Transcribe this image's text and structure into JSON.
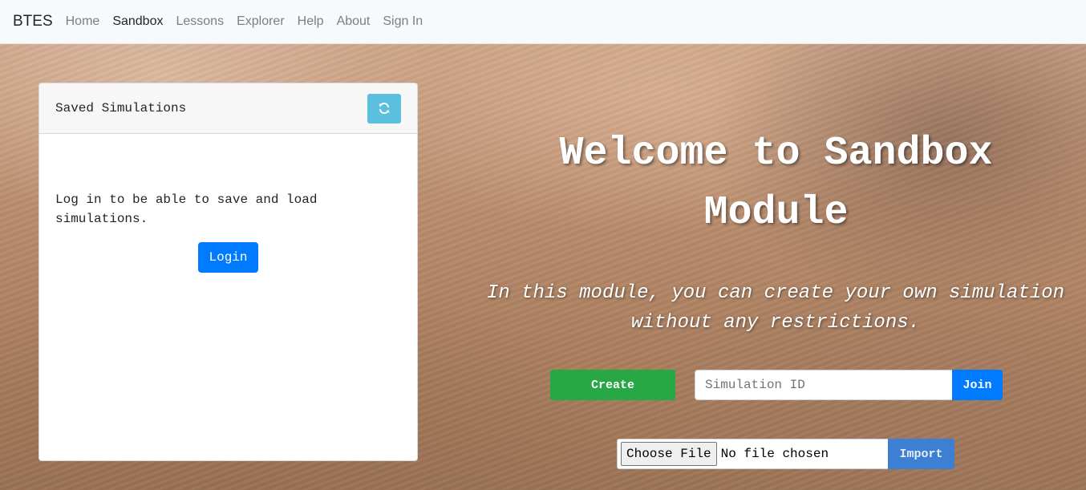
{
  "navbar": {
    "brand": "BTES",
    "links": [
      {
        "label": "Home"
      },
      {
        "label": "Sandbox"
      },
      {
        "label": "Lessons"
      },
      {
        "label": "Explorer"
      },
      {
        "label": "Help"
      },
      {
        "label": "About"
      },
      {
        "label": "Sign In"
      }
    ],
    "active": "Sandbox"
  },
  "saved_panel": {
    "title": "Saved Simulations",
    "refresh_icon": "refresh-icon",
    "message": "Log in to be able to save and load simulations.",
    "login_label": "Login"
  },
  "hero": {
    "title": "Welcome to Sandbox Module",
    "subtitle": "In this module, you can create your own simulation without any restrictions.",
    "create_label": "Create",
    "simulation_id_placeholder": "Simulation ID",
    "simulation_id_value": "",
    "join_label": "Join",
    "choose_file_label": "Choose File",
    "file_status": "No file chosen",
    "import_label": "Import"
  },
  "colors": {
    "primary": "#007bff",
    "success": "#28a745",
    "info": "#5bc0de",
    "navbar_bg": "#f8f9fa"
  }
}
